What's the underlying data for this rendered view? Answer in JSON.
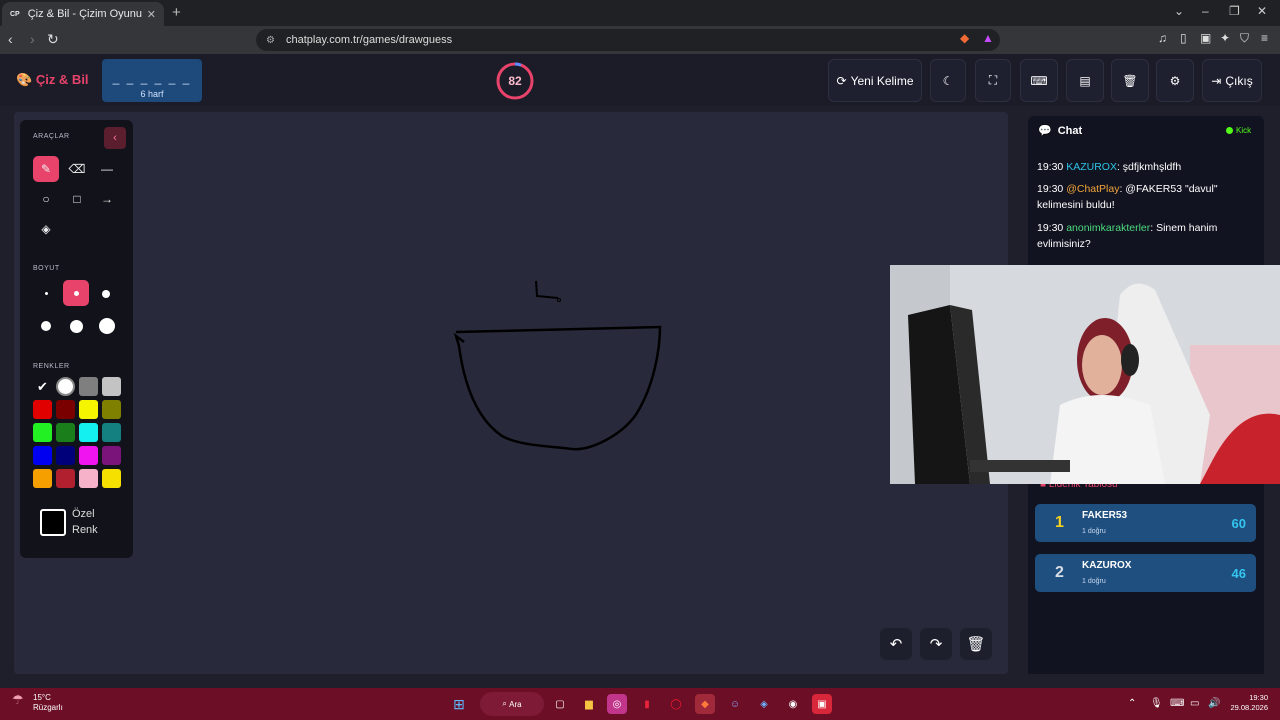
{
  "browser": {
    "tab_favicon": "CP",
    "tab_title": "Çiz & Bil - Çizim Oyunu",
    "url": "chatplay.com.tr/games/drawguess"
  },
  "header": {
    "logo": "Çiz & Bil",
    "word_mask": "_ _ _ _ _ _",
    "word_length": "6 harf",
    "timer": "82",
    "timer_progress": 0.95,
    "new_word": "Yeni Kelime",
    "logout": "Çıkış"
  },
  "tools": {
    "tools_label": "ARAÇLAR",
    "size_label": "BOYUT",
    "colors_label": "RENKLER",
    "custom_color": "Özel Renk",
    "selected_tool": "pen",
    "selected_size": 2,
    "colors": [
      "#000000",
      "#ffffff",
      "#7f7f7f",
      "#c3c3c3",
      "#e00000",
      "#7a0000",
      "#f5f500",
      "#808000",
      "#22f022",
      "#1a7f1a",
      "#14f0f0",
      "#148080",
      "#0000f0",
      "#00007a",
      "#f014f0",
      "#7a147a",
      "#f5a000",
      "#b0202f",
      "#f5b2c8",
      "#f5e000"
    ]
  },
  "chat": {
    "title": "Chat",
    "platform": "Kick",
    "messages": [
      {
        "time": "19:30",
        "user": "KAZUROX",
        "text": ": şdfjkmhşldfh"
      },
      {
        "time": "19:30",
        "user": "@ChatPlay",
        "text": ": @FAKER53 \"davul\" kelimesini buldu!"
      },
      {
        "time": "19:30",
        "user": "anonimkarakterler",
        "text": ": Sinem hanim evlimisiniz?"
      }
    ]
  },
  "leaderboard": {
    "title": "Liderlik Tablosu",
    "rows": [
      {
        "rank": "1",
        "name": "FAKER53",
        "sub": "1 doğru",
        "score": "60",
        "rank_color": "#f5d020"
      },
      {
        "rank": "2",
        "name": "KAZUROX",
        "sub": "1 doğru",
        "score": "46",
        "rank_color": "#d8dde6"
      }
    ]
  },
  "taskbar": {
    "temp": "15°C",
    "weather": "Rüzgarlı",
    "search": "Ara",
    "time": "19:30",
    "date": "29.08.2026"
  }
}
